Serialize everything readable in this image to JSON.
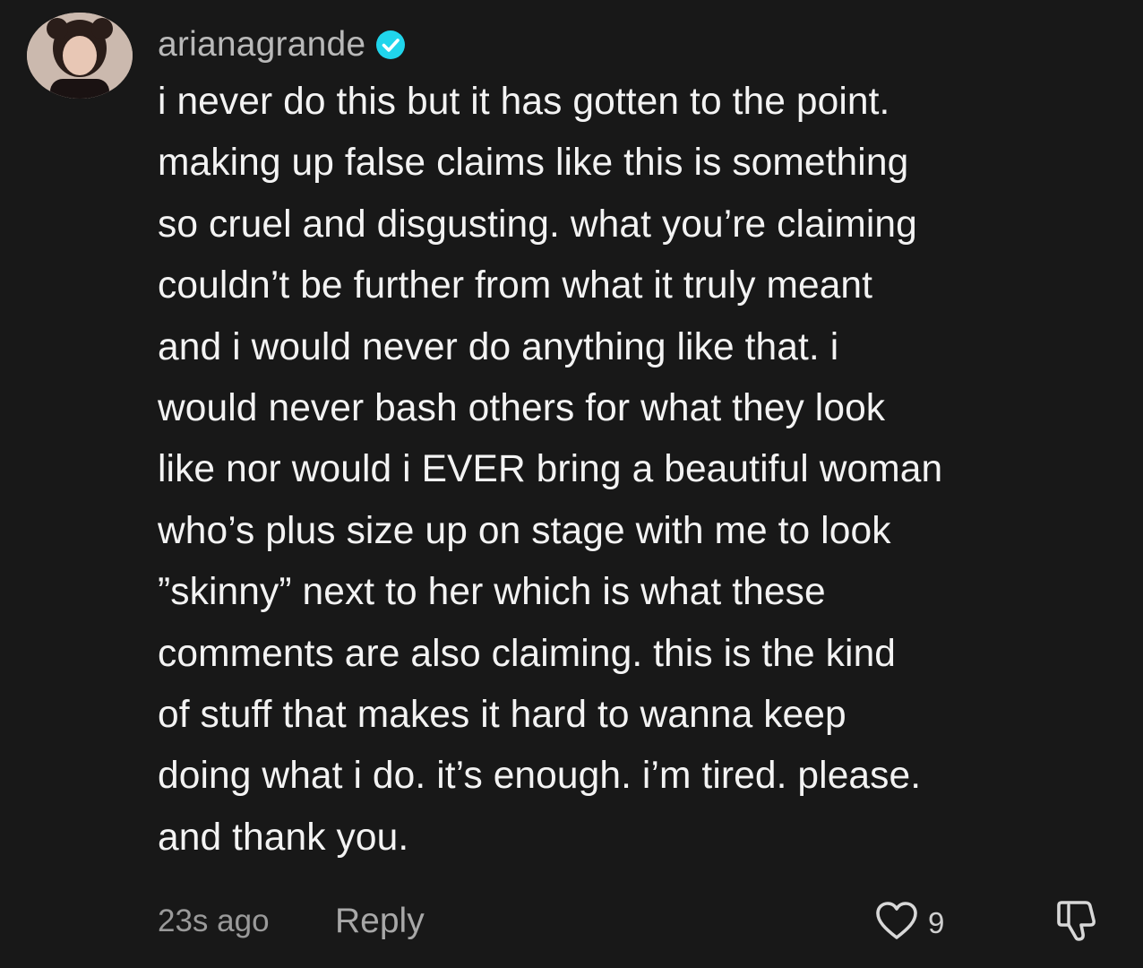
{
  "comment": {
    "username": "arianagrande",
    "verified": true,
    "lines": [
      "i never do this but it has gotten to the point.",
      "making up false claims like this is something",
      "so cruel and disgusting. what you’re claiming",
      "couldn’t be further from what it truly meant",
      "and i would never do anything like that. i",
      "would never bash others for what they look",
      "like nor would i EVER bring a beautiful woman",
      "who’s plus size up on stage with me to look",
      "”skinny” next to her which is what these",
      "comments are also claiming. this is the kind",
      "of stuff that makes it hard to wanna keep",
      "doing what i do. it’s enough. i’m tired. please.",
      "and thank you."
    ],
    "time": "23s ago",
    "reply_label": "Reply",
    "like_count": "9"
  },
  "icons": {
    "verified": "verified-badge-icon",
    "like": "heart-outline-icon",
    "dislike": "thumbs-down-outline-icon"
  },
  "colors": {
    "background": "#181818",
    "verified": "#20d5ec"
  }
}
